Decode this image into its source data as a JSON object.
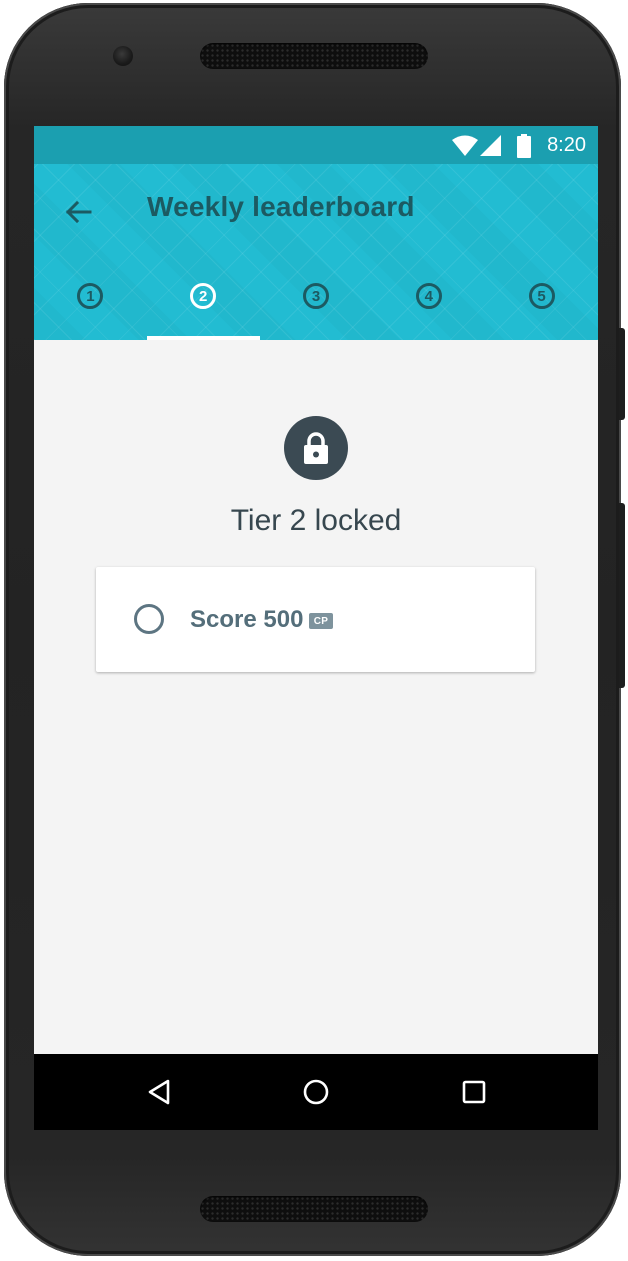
{
  "status_bar": {
    "time": "8:20",
    "icons": [
      "wifi-icon",
      "signal-icon",
      "battery-icon"
    ]
  },
  "app_bar": {
    "title": "Weekly leaderboard",
    "back_icon": "arrow-back-icon"
  },
  "tabs": [
    {
      "label": "1",
      "active": false
    },
    {
      "label": "2",
      "active": true
    },
    {
      "label": "3",
      "active": false
    },
    {
      "label": "4",
      "active": false
    },
    {
      "label": "5",
      "active": false
    }
  ],
  "content": {
    "lock_icon": "lock-icon",
    "locked_title": "Tier 2 locked",
    "requirement": {
      "label": "Score 500",
      "badge": "CP",
      "checked": false
    }
  },
  "nav_bar": {
    "buttons": [
      "back-triangle-icon",
      "home-circle-icon",
      "recents-square-icon"
    ]
  },
  "colors": {
    "status_bar": "#1b9fb0",
    "app_bar": "#22bcd2",
    "title_text": "#1c5a62",
    "content_bg": "#f4f4f4",
    "lock_bg": "#3b4a53"
  }
}
